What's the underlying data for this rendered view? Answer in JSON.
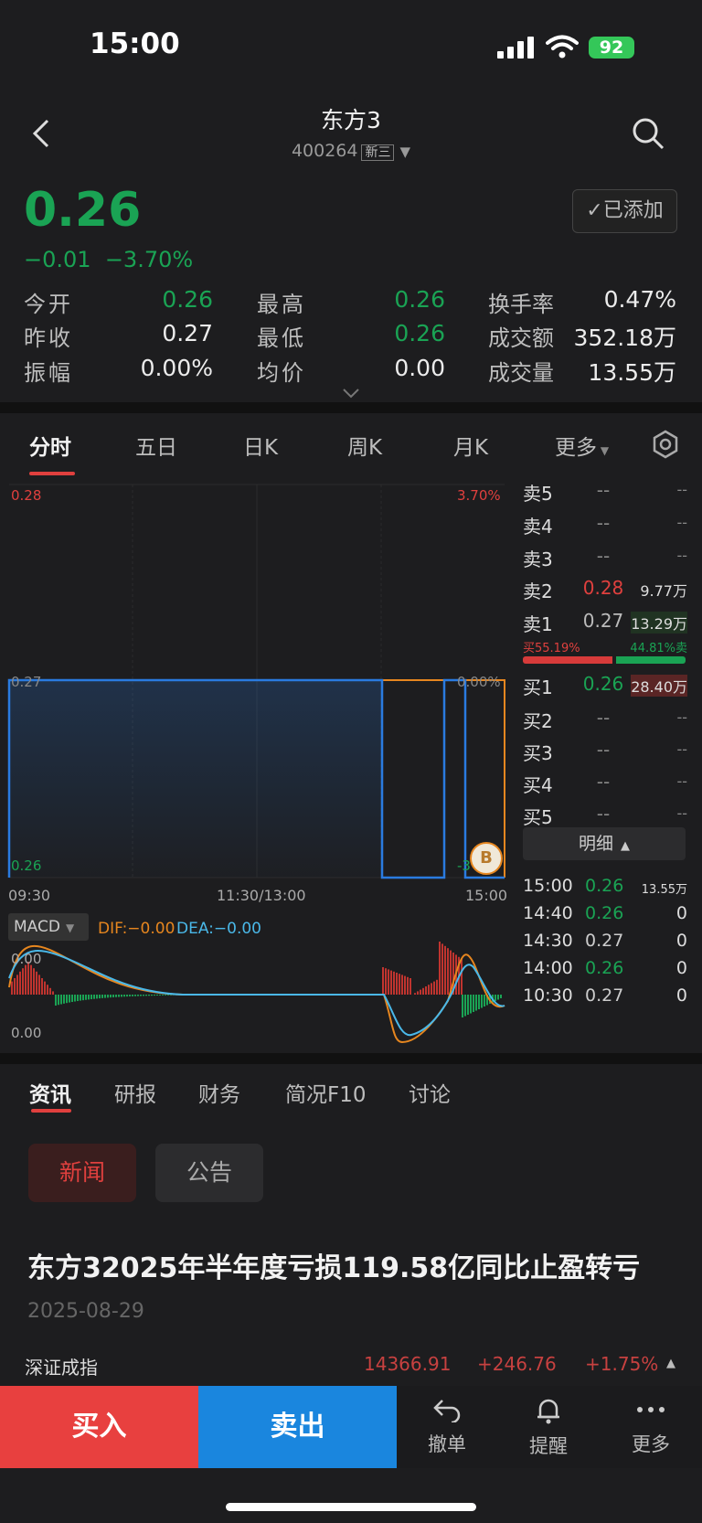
{
  "status": {
    "time": "15:00",
    "battery": "92"
  },
  "header": {
    "name": "东方3",
    "code": "400264",
    "market_tag": "新三",
    "price": "0.26",
    "change": "−0.01",
    "change_pct": "−3.70%",
    "added_label": "已添加"
  },
  "stats": {
    "open_label": "今开",
    "open": "0.26",
    "high_label": "最高",
    "high": "0.26",
    "turnover_label": "换手率",
    "turnover": "0.47%",
    "prev_close_label": "昨收",
    "prev_close": "0.27",
    "low_label": "最低",
    "low": "0.26",
    "amount_label": "成交额",
    "amount": "352.18万",
    "amplitude_label": "振幅",
    "amplitude": "0.00%",
    "avg_label": "均价",
    "avg": "0.00",
    "volume_label": "成交量",
    "volume": "13.55万"
  },
  "chart_tabs": [
    "分时",
    "五日",
    "日K",
    "周K",
    "月K",
    "更多"
  ],
  "chart": {
    "y_max": "0.28",
    "y_mid": "0.27",
    "y_min": "0.26",
    "pct_max": "3.70%",
    "pct_mid": "0.00%",
    "pct_min": "-3",
    "time_start": "09:30",
    "time_mid": "11:30/13:00",
    "time_end": "15:00",
    "indicator": "MACD",
    "dif": "DIF:−0.00",
    "dea": "DEA:−0.00",
    "macd_top": "0.00",
    "macd_bottom": "0.00",
    "colors": {
      "price_line": "#2a7be0",
      "avg_line": "#e6861f",
      "dif": "#e6861f",
      "dea": "#4ab8e8",
      "up": "#c0342f",
      "down": "#1aa354"
    }
  },
  "order_book": {
    "asks": [
      {
        "label": "卖5",
        "price": "--",
        "vol": "--"
      },
      {
        "label": "卖4",
        "price": "--",
        "vol": "--"
      },
      {
        "label": "卖3",
        "price": "--",
        "vol": "--"
      },
      {
        "label": "卖2",
        "price": "0.28",
        "vol": "9.77万"
      },
      {
        "label": "卖1",
        "price": "0.27",
        "vol": "13.29万"
      }
    ],
    "buy_ratio": "买55.19%",
    "sell_ratio": "44.81%卖",
    "buy_fraction": 0.5519,
    "bids": [
      {
        "label": "买1",
        "price": "0.26",
        "vol": "28.40万"
      },
      {
        "label": "买2",
        "price": "--",
        "vol": "--"
      },
      {
        "label": "买3",
        "price": "--",
        "vol": "--"
      },
      {
        "label": "买4",
        "price": "--",
        "vol": "--"
      },
      {
        "label": "买5",
        "price": "--",
        "vol": "--"
      }
    ],
    "detail_label": "明细",
    "ticks": [
      {
        "time": "15:00",
        "price": "0.26",
        "vol": "13.55万"
      },
      {
        "time": "14:40",
        "price": "0.26",
        "vol": "0"
      },
      {
        "time": "14:30",
        "price": "0.27",
        "vol": "0"
      },
      {
        "time": "14:00",
        "price": "0.26",
        "vol": "0"
      },
      {
        "time": "10:30",
        "price": "0.27",
        "vol": "0"
      }
    ]
  },
  "news_tabs": [
    "资讯",
    "研报",
    "财务",
    "简况F10",
    "讨论"
  ],
  "news": {
    "pill_news": "新闻",
    "pill_announce": "公告",
    "headline": "东方32025年半年度亏损119.58亿同比止盈转亏",
    "date": "2025-08-29"
  },
  "index_bar": {
    "name": "深证成指",
    "value": "14366.91",
    "change": "+246.76",
    "pct": "+1.75%"
  },
  "bottom": {
    "buy": "买入",
    "sell": "卖出",
    "cancel": "撤单",
    "alert": "提醒",
    "more": "更多"
  }
}
